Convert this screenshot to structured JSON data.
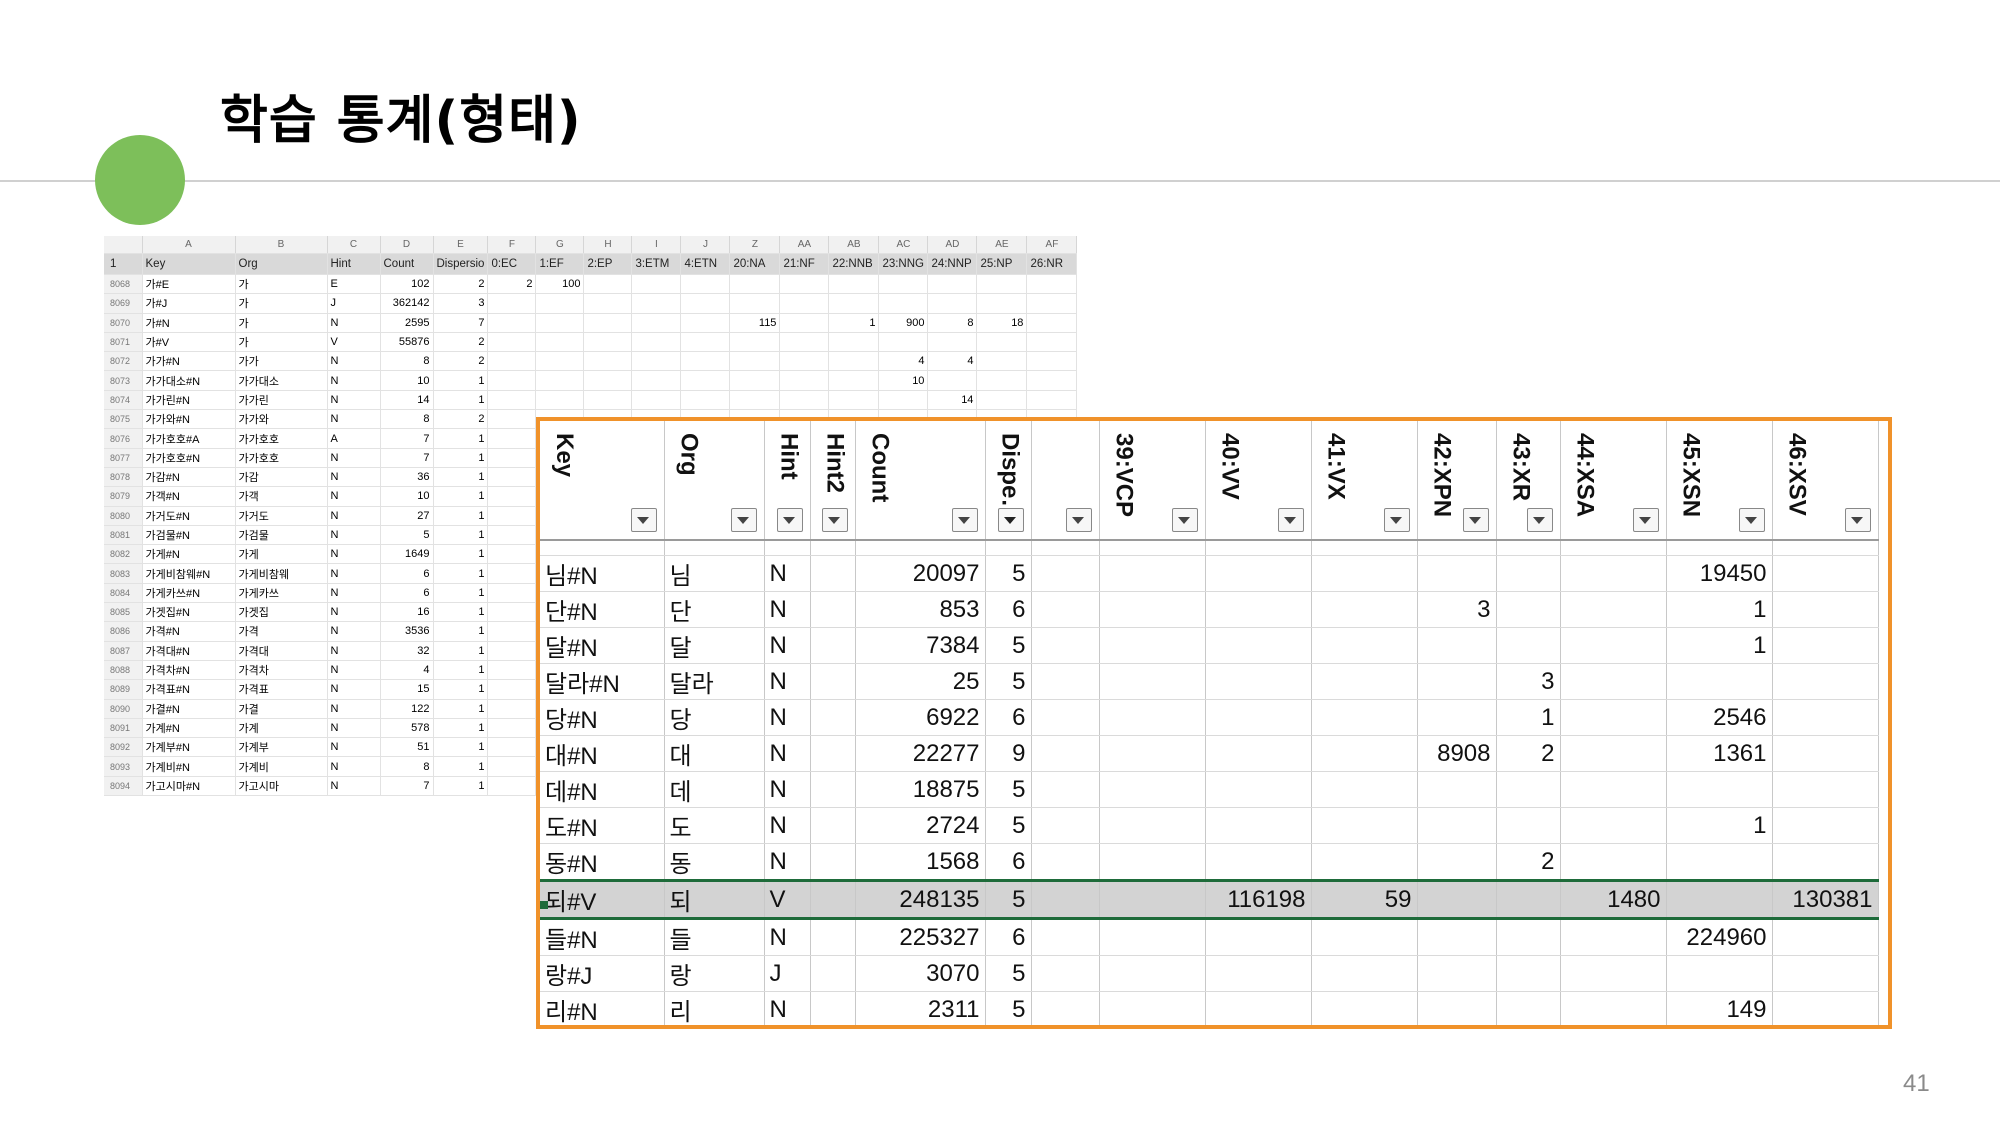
{
  "slide": {
    "title": "학습 통계(형태)",
    "page_number": "41"
  },
  "small_sheet": {
    "col_letters": [
      "",
      "A",
      "B",
      "C",
      "D",
      "E",
      "F",
      "G",
      "H",
      "I",
      "J",
      "Z",
      "AA",
      "AB",
      "AC",
      "AD",
      "AE",
      "AF"
    ],
    "header_row": {
      "num": "1",
      "cells": [
        "Key",
        "Org",
        "Hint",
        "Count",
        "Dispersio",
        "0:EC",
        "1:EF",
        "2:EP",
        "3:ETM",
        "4:ETN",
        "20:NA",
        "21:NF",
        "22:NNB",
        "23:NNG",
        "24:NNP",
        "25:NP",
        "26:NR"
      ]
    },
    "rows": [
      {
        "num": "8068",
        "cells": [
          "가#E",
          "가",
          "E",
          "102",
          "2",
          "2",
          "100",
          "",
          "",
          "",
          "",
          "",
          "",
          "",
          "",
          "",
          ""
        ]
      },
      {
        "num": "8069",
        "cells": [
          "가#J",
          "가",
          "J",
          "362142",
          "3",
          "",
          "",
          "",
          "",
          "",
          "",
          "",
          "",
          "",
          "",
          "",
          ""
        ]
      },
      {
        "num": "8070",
        "cells": [
          "가#N",
          "가",
          "N",
          "2595",
          "7",
          "",
          "",
          "",
          "",
          "",
          "115",
          "",
          "1",
          "900",
          "8",
          "18",
          ""
        ]
      },
      {
        "num": "8071",
        "cells": [
          "가#V",
          "가",
          "V",
          "55876",
          "2",
          "",
          "",
          "",
          "",
          "",
          "",
          "",
          "",
          "",
          "",
          "",
          ""
        ]
      },
      {
        "num": "8072",
        "cells": [
          "가가#N",
          "가가",
          "N",
          "8",
          "2",
          "",
          "",
          "",
          "",
          "",
          "",
          "",
          "",
          "4",
          "4",
          "",
          ""
        ]
      },
      {
        "num": "8073",
        "cells": [
          "가가대소#N",
          "가가대소",
          "N",
          "10",
          "1",
          "",
          "",
          "",
          "",
          "",
          "",
          "",
          "",
          "10",
          "",
          "",
          ""
        ]
      },
      {
        "num": "8074",
        "cells": [
          "가가린#N",
          "가가린",
          "N",
          "14",
          "1",
          "",
          "",
          "",
          "",
          "",
          "",
          "",
          "",
          "",
          "14",
          "",
          ""
        ]
      },
      {
        "num": "8075",
        "cells": [
          "가가와#N",
          "가가와",
          "N",
          "8",
          "2",
          "",
          "",
          "",
          "",
          "",
          "",
          "",
          "",
          "",
          "",
          "",
          ""
        ]
      },
      {
        "num": "8076",
        "cells": [
          "가가호호#A",
          "가가호호",
          "A",
          "7",
          "1",
          "",
          "",
          "",
          "",
          "",
          "",
          "",
          "",
          "",
          "",
          "",
          ""
        ]
      },
      {
        "num": "8077",
        "cells": [
          "가가호호#N",
          "가가호호",
          "N",
          "7",
          "1",
          "",
          "",
          "",
          "",
          "",
          "",
          "",
          "",
          "",
          "",
          "",
          ""
        ]
      },
      {
        "num": "8078",
        "cells": [
          "가감#N",
          "가감",
          "N",
          "36",
          "1",
          "",
          "",
          "",
          "",
          "",
          "",
          "",
          "",
          "",
          "",
          "",
          ""
        ]
      },
      {
        "num": "8079",
        "cells": [
          "가객#N",
          "가객",
          "N",
          "10",
          "1",
          "",
          "",
          "",
          "",
          "",
          "",
          "",
          "",
          "",
          "",
          "",
          ""
        ]
      },
      {
        "num": "8080",
        "cells": [
          "가거도#N",
          "가거도",
          "N",
          "27",
          "1",
          "",
          "",
          "",
          "",
          "",
          "",
          "",
          "",
          "",
          "",
          "",
          ""
        ]
      },
      {
        "num": "8081",
        "cells": [
          "가검물#N",
          "가검물",
          "N",
          "5",
          "1",
          "",
          "",
          "",
          "",
          "",
          "",
          "",
          "",
          "",
          "",
          "",
          ""
        ]
      },
      {
        "num": "8082",
        "cells": [
          "가게#N",
          "가게",
          "N",
          "1649",
          "1",
          "",
          "",
          "",
          "",
          "",
          "",
          "",
          "",
          "",
          "",
          "",
          ""
        ]
      },
      {
        "num": "8083",
        "cells": [
          "가게비참웨#N",
          "가게비참웨",
          "N",
          "6",
          "1",
          "",
          "",
          "",
          "",
          "",
          "",
          "",
          "",
          "",
          "",
          "",
          ""
        ]
      },
      {
        "num": "8084",
        "cells": [
          "가게카쓰#N",
          "가게카쓰",
          "N",
          "6",
          "1",
          "",
          "",
          "",
          "",
          "",
          "",
          "",
          "",
          "",
          "",
          "",
          ""
        ]
      },
      {
        "num": "8085",
        "cells": [
          "가겟집#N",
          "가겟집",
          "N",
          "16",
          "1",
          "",
          "",
          "",
          "",
          "",
          "",
          "",
          "",
          "",
          "",
          "",
          ""
        ]
      },
      {
        "num": "8086",
        "cells": [
          "가격#N",
          "가격",
          "N",
          "3536",
          "1",
          "",
          "",
          "",
          "",
          "",
          "",
          "",
          "",
          "",
          "",
          "",
          ""
        ]
      },
      {
        "num": "8087",
        "cells": [
          "가격대#N",
          "가격대",
          "N",
          "32",
          "1",
          "",
          "",
          "",
          "",
          "",
          "",
          "",
          "",
          "",
          "",
          "",
          ""
        ]
      },
      {
        "num": "8088",
        "cells": [
          "가격차#N",
          "가격차",
          "N",
          "4",
          "1",
          "",
          "",
          "",
          "",
          "",
          "",
          "",
          "",
          "",
          "",
          "",
          ""
        ]
      },
      {
        "num": "8089",
        "cells": [
          "가격표#N",
          "가격표",
          "N",
          "15",
          "1",
          "",
          "",
          "",
          "",
          "",
          "",
          "",
          "",
          "",
          "",
          "",
          ""
        ]
      },
      {
        "num": "8090",
        "cells": [
          "가결#N",
          "가결",
          "N",
          "122",
          "1",
          "",
          "",
          "",
          "",
          "",
          "",
          "",
          "",
          "",
          "",
          "",
          ""
        ]
      },
      {
        "num": "8091",
        "cells": [
          "가계#N",
          "가계",
          "N",
          "578",
          "1",
          "",
          "",
          "",
          "",
          "",
          "",
          "",
          "",
          "",
          "",
          "",
          ""
        ]
      },
      {
        "num": "8092",
        "cells": [
          "가계부#N",
          "가계부",
          "N",
          "51",
          "1",
          "",
          "",
          "",
          "",
          "",
          "",
          "",
          "",
          "",
          "",
          "",
          ""
        ]
      },
      {
        "num": "8093",
        "cells": [
          "가계비#N",
          "가계비",
          "N",
          "8",
          "1",
          "",
          "",
          "",
          "",
          "",
          "",
          "",
          "",
          "",
          "",
          "",
          ""
        ]
      },
      {
        "num": "8094",
        "cells": [
          "가고시마#N",
          "가고시마",
          "N",
          "7",
          "1",
          "",
          "",
          "",
          "",
          "",
          "",
          "",
          "",
          "",
          "",
          "",
          ""
        ]
      }
    ]
  },
  "big_sheet": {
    "headers": [
      "Key",
      "Org",
      "Hint",
      "Hint2",
      "Count",
      "Dispersi...",
      "",
      "39:VCP",
      "40:VV",
      "41:VX",
      "42:XPN",
      "43:XR",
      "44:XSA",
      "45:XSN",
      "46:XSV"
    ],
    "rows": [
      {
        "cells": [
          "님#N",
          "님",
          "N",
          "",
          "20097",
          "5",
          "",
          "",
          "",
          "",
          "",
          "",
          "",
          "19450",
          ""
        ]
      },
      {
        "cells": [
          "단#N",
          "단",
          "N",
          "",
          "853",
          "6",
          "",
          "",
          "",
          "",
          "3",
          "",
          "",
          "1",
          ""
        ]
      },
      {
        "cells": [
          "달#N",
          "달",
          "N",
          "",
          "7384",
          "5",
          "",
          "",
          "",
          "",
          "",
          "",
          "",
          "1",
          ""
        ]
      },
      {
        "cells": [
          "달라#N",
          "달라",
          "N",
          "",
          "25",
          "5",
          "",
          "",
          "",
          "",
          "",
          "3",
          "",
          "",
          ""
        ]
      },
      {
        "cells": [
          "당#N",
          "당",
          "N",
          "",
          "6922",
          "6",
          "",
          "",
          "",
          "",
          "",
          "1",
          "",
          "2546",
          ""
        ]
      },
      {
        "cells": [
          "대#N",
          "대",
          "N",
          "",
          "22277",
          "9",
          "",
          "",
          "",
          "",
          "8908",
          "2",
          "",
          "1361",
          ""
        ]
      },
      {
        "cells": [
          "데#N",
          "데",
          "N",
          "",
          "18875",
          "5",
          "",
          "",
          "",
          "",
          "",
          "",
          "",
          "",
          ""
        ]
      },
      {
        "cells": [
          "도#N",
          "도",
          "N",
          "",
          "2724",
          "5",
          "",
          "",
          "",
          "",
          "",
          "",
          "",
          "1",
          ""
        ]
      },
      {
        "cells": [
          "동#N",
          "동",
          "N",
          "",
          "1568",
          "6",
          "",
          "",
          "",
          "",
          "",
          "2",
          "",
          "",
          ""
        ]
      },
      {
        "cells": [
          "되#V",
          "되",
          "V",
          "",
          "248135",
          "5",
          "",
          "",
          "116198",
          "59",
          "",
          "",
          "1480",
          "",
          "130381"
        ],
        "selected": true
      },
      {
        "cells": [
          "들#N",
          "들",
          "N",
          "",
          "225327",
          "6",
          "",
          "",
          "",
          "",
          "",
          "",
          "",
          "224960",
          ""
        ]
      },
      {
        "cells": [
          "랑#J",
          "랑",
          "J",
          "",
          "3070",
          "5",
          "",
          "",
          "",
          "",
          "",
          "",
          "",
          "",
          ""
        ]
      },
      {
        "cells": [
          "리#N",
          "리",
          "N",
          "",
          "2311",
          "5",
          "",
          "",
          "",
          "",
          "",
          "",
          "",
          "149",
          ""
        ]
      }
    ]
  }
}
